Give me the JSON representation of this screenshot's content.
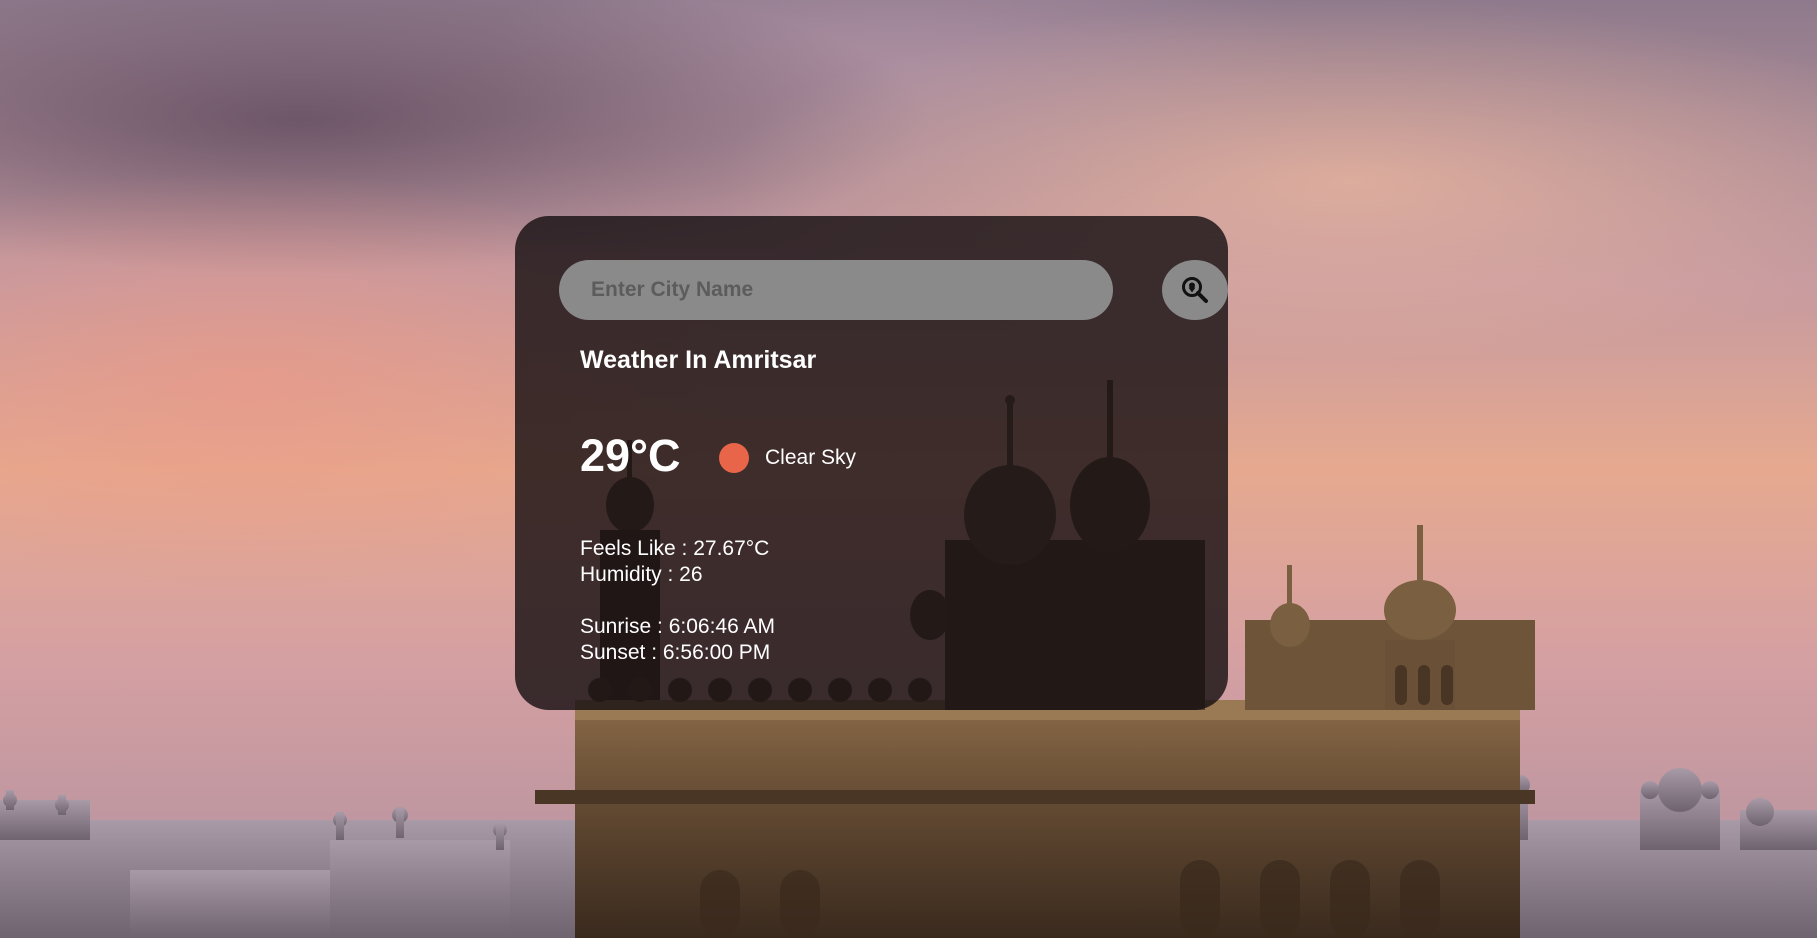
{
  "search": {
    "placeholder": "Enter City Name",
    "value": ""
  },
  "weather": {
    "title": "Weather In Amritsar",
    "temperature": "29°C",
    "condition": "Clear Sky",
    "feels_like": "Feels Like : 27.67°C",
    "humidity": "Humidity : 26",
    "sunrise": "Sunrise : 6:06:46 AM",
    "sunset": "Sunset : 6:56:00 PM"
  },
  "icons": {
    "search_button_icon": "location-search-icon",
    "condition_icon": "clear-sky-icon"
  },
  "colors": {
    "card_background": "rgba(20,14,16,0.80)",
    "input_background": "#8a8a8a",
    "sun_dot": "#e8654a",
    "text": "#ffffff"
  }
}
